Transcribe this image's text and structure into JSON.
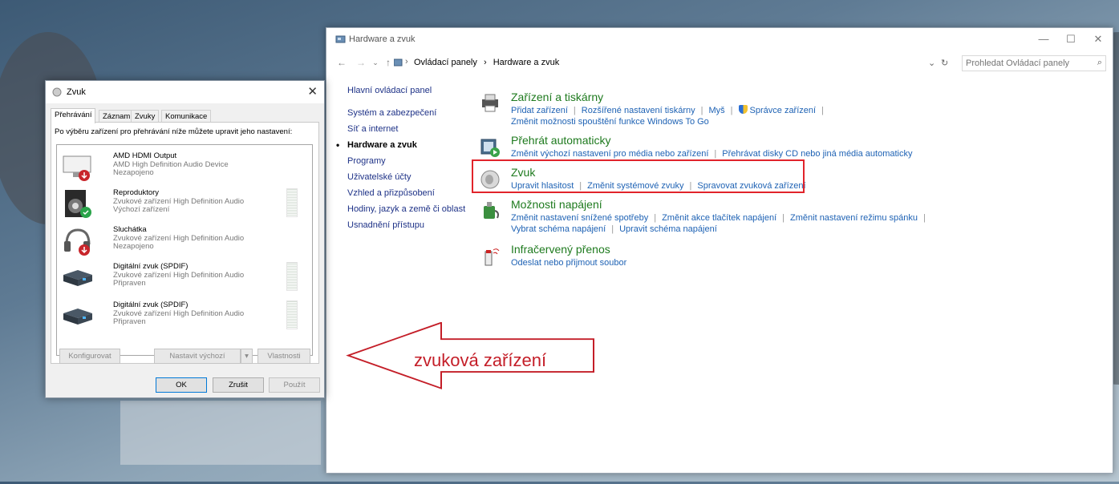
{
  "colors": {
    "highlight_red": "#e1242b",
    "link_blue": "#1e62b4",
    "category_green": "#1e7a1e"
  },
  "control_panel": {
    "title": "Hardware a zvuk",
    "breadcrumbs": [
      "Ovládací panely",
      "›",
      "Hardware a zvuk"
    ],
    "search_placeholder": "Prohledat Ovládací panely",
    "left_nav": [
      "Hlavní ovládací panel",
      "Systém a zabezpečení",
      "Síť a internet",
      "Hardware a zvuk",
      "Programy",
      "Uživatelské účty",
      "Vzhled a přizpůsobení",
      "Hodiny, jazyk a země či oblast",
      "Usnadnění přístupu"
    ],
    "categories": {
      "devices": {
        "title": "Zařízení a tiskárny",
        "links_row1": [
          "Přidat zařízení",
          "Rozšířené nastavení tiskárny",
          "Myš",
          "Správce zařízení"
        ],
        "links_row2": [
          "Změnit možnosti spouštění funkce Windows To Go"
        ]
      },
      "autoplay": {
        "title": "Přehrát automaticky",
        "links_row1": [
          "Změnit výchozí nastavení pro média nebo zařízení",
          "Přehrávat disky CD nebo jiná média automaticky"
        ]
      },
      "sound": {
        "title": "Zvuk",
        "links_row1": [
          "Upravit hlasitost",
          "Změnit systémové zvuky",
          "Spravovat zvuková zařízení"
        ]
      },
      "power": {
        "title": "Možnosti napájení",
        "links_row1": [
          "Změnit nastavení snížené spotřeby",
          "Změnit akce tlačítek napájení",
          "Změnit nastavení režimu spánku"
        ],
        "links_row2": [
          "Vybrat schéma napájení",
          "Upravit schéma napájení"
        ]
      },
      "infrared": {
        "title": "Infračervený přenos",
        "links_row1": [
          "Odeslat nebo přijmout soubor"
        ]
      }
    }
  },
  "sound_dialog": {
    "title": "Zvuk",
    "tabs": [
      "Přehrávání",
      "Záznam",
      "Zvuky",
      "Komunikace"
    ],
    "intro": "Po výběru zařízení pro přehrávání níže můžete upravit jeho nastavení:",
    "devices": [
      {
        "name": "AMD HDMI Output",
        "desc": "AMD High Definition Audio Device",
        "status": "Nezapojeno",
        "icon": "monitor-icon"
      },
      {
        "name": "Reproduktory",
        "desc": "Zvukové zařízení High Definition Audio",
        "status": "Výchozí zařízení",
        "icon": "speaker-icon"
      },
      {
        "name": "Sluchátka",
        "desc": "Zvukové zařízení High Definition Audio",
        "status": "Nezapojeno",
        "icon": "headphones-icon"
      },
      {
        "name": "Digitální zvuk (SPDIF)",
        "desc": "Zvukové zařízení High Definition Audio",
        "status": "Připraven",
        "icon": "spdif-icon"
      },
      {
        "name": "Digitální zvuk (SPDIF)",
        "desc": "Zvukové zařízení High Definition Audio",
        "status": "Připraven",
        "icon": "spdif-icon"
      }
    ],
    "buttons": {
      "configure": "Konfigurovat",
      "set_default": "Nastavit výchozí",
      "properties": "Vlastnosti",
      "ok": "OK",
      "cancel": "Zrušit",
      "apply": "Použít"
    }
  },
  "annotation": {
    "label": "zvuková zařízení"
  }
}
